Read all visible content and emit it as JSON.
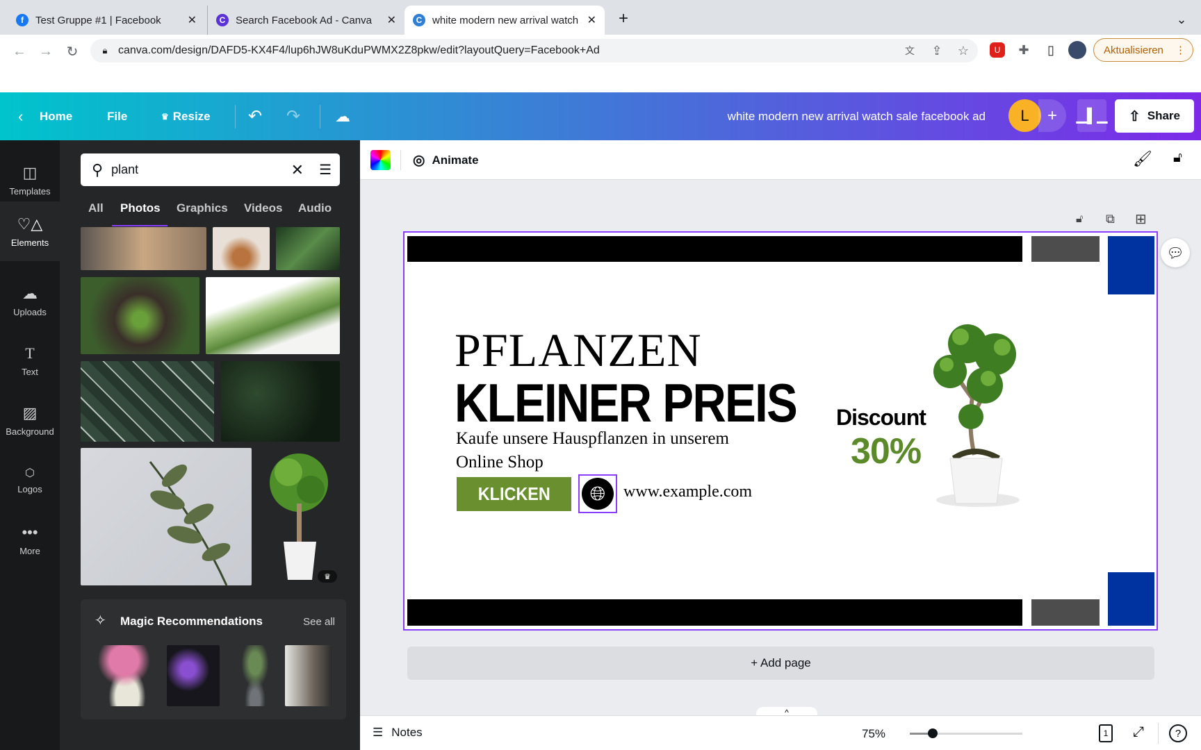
{
  "browser": {
    "tabs": [
      {
        "title": "Test Gruppe #1 | Facebook",
        "icon": "facebook-icon"
      },
      {
        "title": "Search Facebook Ad - Canva",
        "icon": "canva-icon"
      },
      {
        "title": "white modern new arrival watch sale facebook ad",
        "icon": "canva-icon",
        "active": true
      }
    ],
    "url": "canva.com/design/DAFD5-KX4F4/lup6hJW8uKduPWMX2Z8pkw/edit?layoutQuery=Facebook+Ad",
    "update_label": "Aktualisieren"
  },
  "header": {
    "home": "Home",
    "file": "File",
    "resize": "Resize",
    "title": "white modern new arrival watch sale facebook ad",
    "avatar_letter": "L",
    "share": "Share"
  },
  "rail": [
    {
      "label": "Templates"
    },
    {
      "label": "Elements"
    },
    {
      "label": "Uploads"
    },
    {
      "label": "Text"
    },
    {
      "label": "Background"
    },
    {
      "label": "Logos"
    },
    {
      "label": "More"
    }
  ],
  "panel": {
    "search_value": "plant",
    "tabs": [
      "All",
      "Photos",
      "Graphics",
      "Videos",
      "Audio"
    ],
    "active_tab": "Photos",
    "magic_title": "Magic Recommendations",
    "see_all": "See all"
  },
  "toolbar": {
    "animate": "Animate"
  },
  "design": {
    "headline1": "PFLANZEN",
    "headline2": "KLEINER PREIS",
    "subtitle1": "Kaufe unsere Hauspflanzen in unserem",
    "subtitle2": "Online Shop",
    "button": "KLICKEN",
    "website": "www.example.com",
    "discount_label": "Discount",
    "discount_value": "30%",
    "colors": {
      "green": "#6a8f2f",
      "blue": "#0033a0",
      "gray": "#4d4d4d",
      "black": "#000000"
    }
  },
  "add_page": "+ Add page",
  "footer": {
    "notes": "Notes",
    "zoom": "75%",
    "zoom_level_percent": 75,
    "page": "1"
  }
}
